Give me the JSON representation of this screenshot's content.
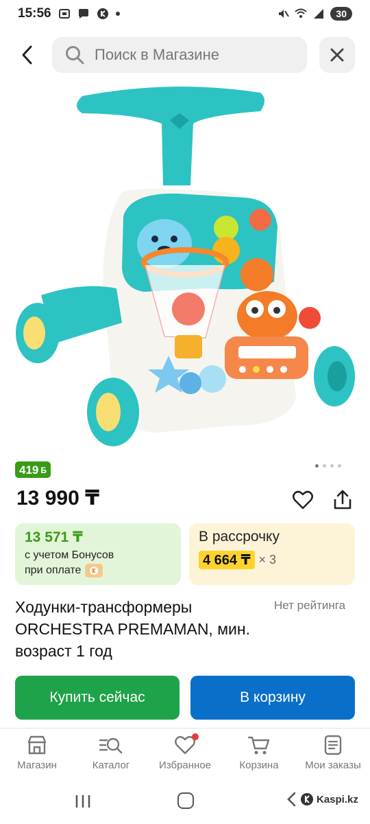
{
  "status_bar": {
    "time": "15:56",
    "battery": "30"
  },
  "search": {
    "placeholder": "Поиск в Магазине"
  },
  "product": {
    "bonus_badge": "419",
    "bonus_badge_mark": "Б",
    "price": "13 990 ₸",
    "title": "Ходунки-трансформеры ORCHESTRA PREMAMAN, мин. возраст 1 год",
    "rating": "Нет рейтинга",
    "image_pager": {
      "total": 4,
      "active_index": 0
    }
  },
  "bonus_card": {
    "amount": "13 571 ₸",
    "line1": "с учетом Бонусов",
    "line2": "при оплате"
  },
  "installment_card": {
    "title": "В рассрочку",
    "amount": "4 664 ₸",
    "multiplier": "× 3"
  },
  "actions": {
    "buy_now": "Купить сейчас",
    "add_to_cart": "В корзину"
  },
  "bottom_nav": {
    "items": [
      {
        "label": "Магазин",
        "icon": "shop-icon"
      },
      {
        "label": "Каталог",
        "icon": "catalog-search-icon"
      },
      {
        "label": "Избранное",
        "icon": "heart-icon",
        "has_notification": true
      },
      {
        "label": "Корзина",
        "icon": "cart-icon"
      },
      {
        "label": "Мои заказы",
        "icon": "orders-icon"
      }
    ]
  },
  "system_nav": {
    "brand": "Kaspi.kz"
  },
  "colors": {
    "bonus_green": "#3a9b18",
    "buy_green": "#1fa34a",
    "cart_blue": "#0a6fc9",
    "installment_yellow": "#ffd32c",
    "notification_red": "#e53935"
  }
}
